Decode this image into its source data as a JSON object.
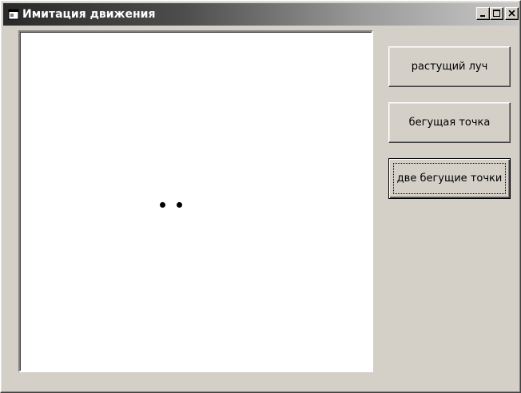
{
  "window": {
    "title": "Имитация движения",
    "icon": "app-window-icon",
    "controls": {
      "minimize_icon": "minimize-icon",
      "maximize_icon": "maximize-icon",
      "close_icon": "close-icon"
    }
  },
  "buttons": {
    "growing_ray": "растущий луч",
    "running_dot": "бегущая точка",
    "two_running_dots": "две бегущие точки"
  },
  "colors": {
    "face": "#d4d0c8",
    "canvas": "#ffffff",
    "dots": "#000000"
  }
}
